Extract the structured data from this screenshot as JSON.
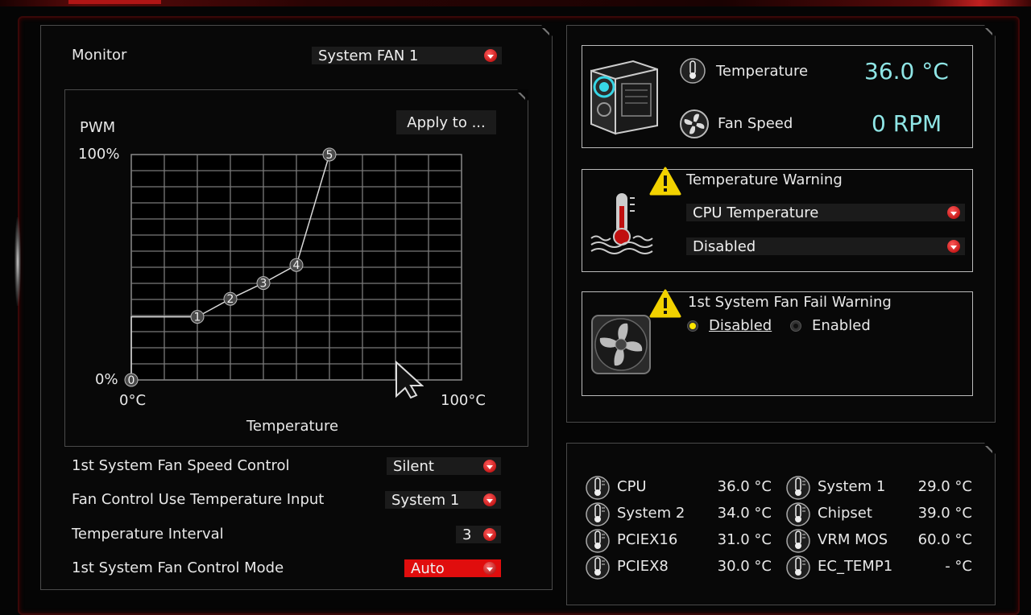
{
  "monitor": {
    "label": "Monitor",
    "value": "System FAN 1"
  },
  "chart": {
    "y_label": "PWM",
    "x_label": "Temperature",
    "apply_button": "Apply to ...",
    "y_max_label": "100%",
    "y_min_label": "0%",
    "x_min_label": "0°C",
    "x_max_label": "100°C"
  },
  "chart_data": {
    "type": "line",
    "xlabel": "Temperature",
    "ylabel": "PWM",
    "xlim": [
      0,
      100
    ],
    "ylim": [
      0,
      100
    ],
    "x": [
      0,
      0,
      20,
      30,
      40,
      50,
      60
    ],
    "y": [
      0,
      28,
      28,
      36,
      43,
      51,
      100
    ],
    "point_labels": [
      "0",
      "",
      "1",
      "2",
      "3",
      "4",
      "5"
    ]
  },
  "settings": [
    {
      "label": "1st System Fan Speed Control",
      "value": "Silent"
    },
    {
      "label": "Fan Control Use Temperature Input",
      "value": "System 1"
    },
    {
      "label": "Temperature Interval",
      "value": "3"
    },
    {
      "label": "1st System Fan Control Mode",
      "value": "Auto"
    }
  ],
  "status": {
    "temp_label": "Temperature",
    "temp_value": "36.0 °C",
    "fan_label": "Fan Speed",
    "fan_value": "0 RPM"
  },
  "temp_warning": {
    "title": "Temperature Warning",
    "source": "CPU Temperature",
    "state": "Disabled"
  },
  "fan_fail": {
    "title": "1st System Fan Fail Warning",
    "option_disabled": "Disabled",
    "option_enabled": "Enabled"
  },
  "sensors": [
    {
      "name": "CPU",
      "value": "36.0 °C"
    },
    {
      "name": "System 1",
      "value": "29.0 °C"
    },
    {
      "name": "System 2",
      "value": "34.0 °C"
    },
    {
      "name": "Chipset",
      "value": "39.0 °C"
    },
    {
      "name": "PCIEX16",
      "value": "31.0 °C"
    },
    {
      "name": "VRM MOS",
      "value": "60.0 °C"
    },
    {
      "name": "PCIEX8",
      "value": "30.0 °C"
    },
    {
      "name": "EC_TEMP1",
      "value": "- °C"
    }
  ],
  "colors": {
    "accent": "#e00d0d",
    "readout": "#8fe6e6",
    "radio_on": "#ffe600"
  }
}
